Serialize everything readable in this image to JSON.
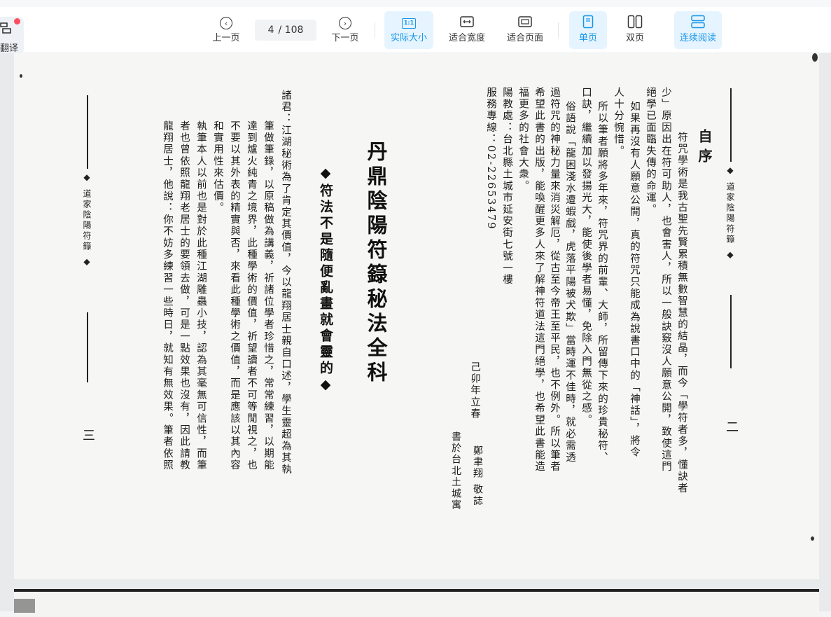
{
  "toolbar": {
    "translate_label": "翻译",
    "prev_label": "上一页",
    "current_page": "4",
    "total_pages": "/ 108",
    "next_label": "下一页",
    "actual_size_label": "实际大小",
    "fit_width_label": "适合宽度",
    "fit_page_label": "适合页面",
    "single_page_label": "单页",
    "double_page_label": "双页",
    "continuous_label": "连续阅读",
    "one_to_one": "1:1"
  },
  "document": {
    "right_page": {
      "header_glyph": "◆ 道家陰陽符籙 ◆",
      "heading": "自序",
      "page_number": "二",
      "columns": [
        "符咒學術是我古聖先賢累積無數智慧的結晶，而今「學符者多，懂訣者",
        "少」原因出在符可助人，也會害人，所以一般訣竅沒人願意公開，致使這門",
        "絕學已面臨失傳的命運。",
        "如果再沒有人願意公開，真的符咒只能成為說書口中的「神話」，將令",
        "人十分惋惜。",
        "所以筆者願將多年來，符咒界的前輩、大師，所留傳下來的珍貴秘符、",
        "口訣，繼續加以發揚光大，能使後學者易懂，免除入門無從之感。",
        "俗語說「龍困淺水遭蝦戲，虎落平陽被犬欺」當時運不佳時，就必需透",
        "過符咒的神秘力量來消災解厄，從古至今帝王至平民，也不例外。所以筆者",
        "希望此書的出版，能喚醒更多人來了解神符道法這門絕學，也希望此書能造",
        "福更多的社會大衆。",
        "陽教處：台北縣土城市延安街七號一樓",
        "服務專線：02-22653479"
      ],
      "date_line": "己卯年立春",
      "author_line": "鄭聿翔 敬誌",
      "place_line": "書於台北土城寓"
    },
    "left_page": {
      "big_title": "丹鼎陰陽符籙秘法全科",
      "subtitle": "◆符法不是隨便亂畫就會靈的◆",
      "header_glyph": "◆ 道家陰陽符籙 ◆",
      "page_number": "三",
      "columns": [
        "諸君：江湖秘術為了肯定其價值，今以龍翔居士親自口述，學生靈超為其執",
        "筆做筆錄，以原稿做為講義，祈諸位學者珍惜之，常常練習，以期能",
        "達到爐火純青之境界，此種學術的價值，祈望讀者不可等閒視之，也",
        "不要以其外表的精實與否，來看此種學術之價值，而是應該以其內容",
        "和實用性來估價。",
        "執筆本人以前也是對於此種江湖雕蟲小技，認為其毫無可信性，而筆",
        "者也曾依照龍翔老居士的要領去做，可是一點效果也沒有，因此請教",
        "龍翔居士，他說：你不妨多練習一些時日，就知有無效果。筆者依照"
      ]
    }
  }
}
